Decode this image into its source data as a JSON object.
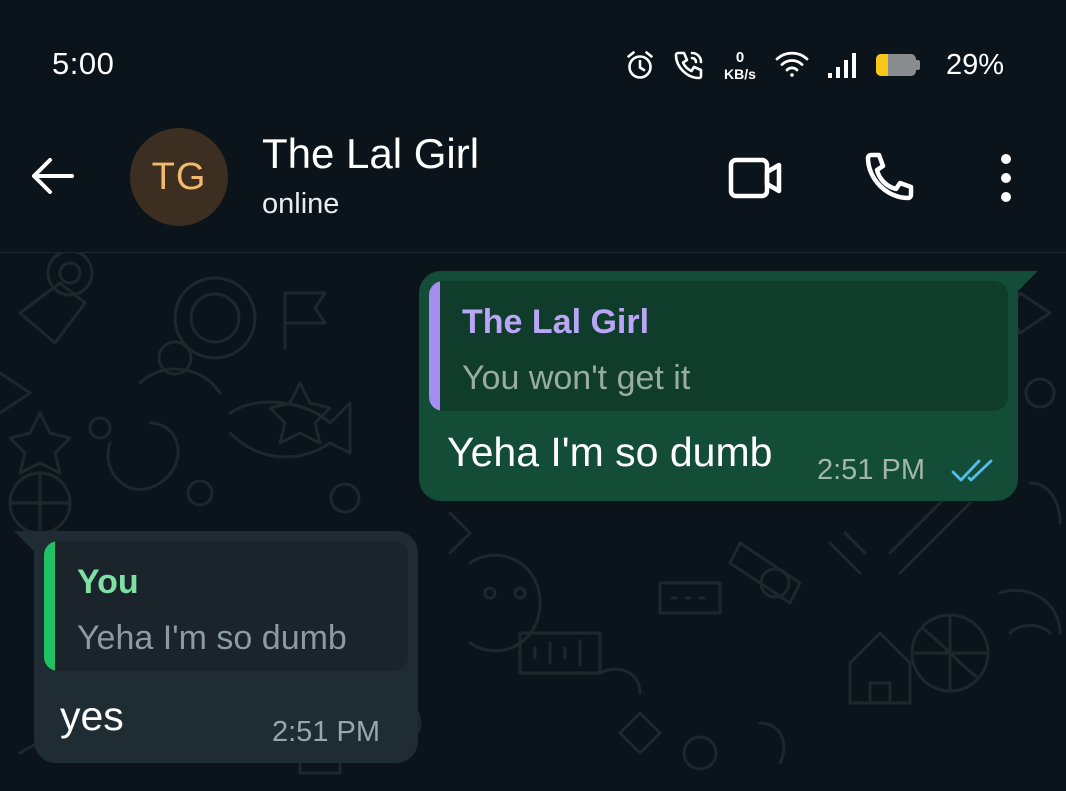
{
  "status_bar": {
    "time": "5:00",
    "net_speed_value": "0",
    "net_speed_unit": "KB/s",
    "battery_level": 0.29,
    "battery_percent": "29%",
    "icons": [
      "alarm-icon",
      "wifi-call-icon",
      "wifi-icon",
      "signal-icon",
      "battery-icon"
    ],
    "battery_color": "#f8c619"
  },
  "header": {
    "avatar_initials": "TG",
    "contact_name": "The Lal Girl",
    "contact_status": "online",
    "icons": [
      "back-arrow-icon",
      "video-call-icon",
      "voice-call-icon",
      "more-options-icon"
    ]
  },
  "messages": [
    {
      "direction": "outgoing",
      "quoted_author": "The Lal Girl",
      "quoted_text": "You won't get it",
      "text": "Yeha I'm so dumb",
      "time": "2:51 PM",
      "status": "read"
    },
    {
      "direction": "incoming",
      "quoted_author": "You",
      "quoted_text": "Yeha I'm so dumb",
      "text": "yes",
      "time": "2:51 PM"
    }
  ],
  "colors": {
    "background": "#0b141a",
    "outgoing_bubble": "#144d37",
    "incoming_bubble": "#1f2c33",
    "read_tick": "#53bdeb",
    "quote_bar_contact": "#a48ef0",
    "quote_bar_you": "#21c063"
  }
}
